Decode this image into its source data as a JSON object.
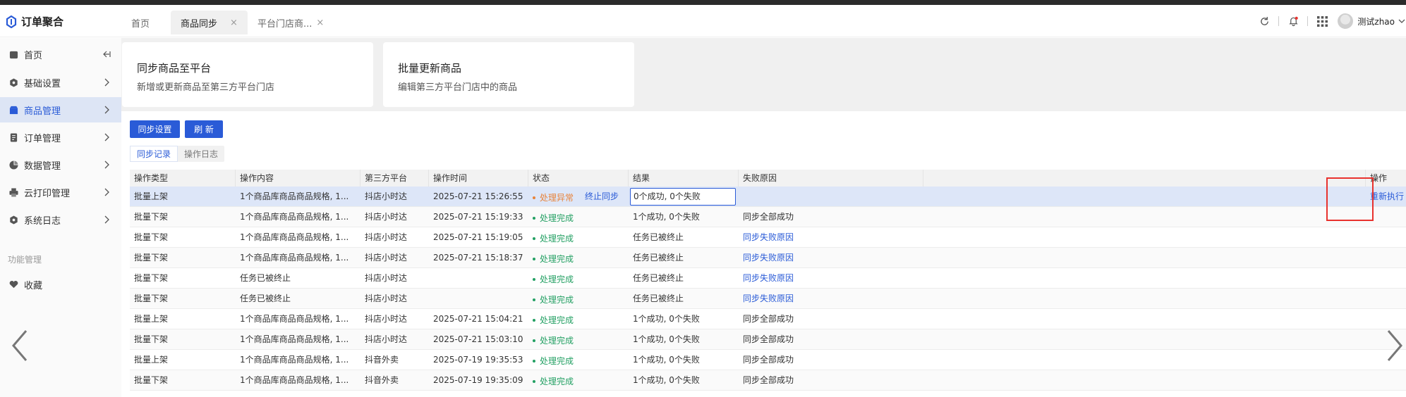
{
  "app": {
    "title": "订单聚合"
  },
  "tabs": [
    {
      "label": "首页"
    },
    {
      "label": "商品同步",
      "close": "×"
    },
    {
      "label": "平台门店商...",
      "close": "×"
    }
  ],
  "header": {
    "username": "测试zhao"
  },
  "sidebar": {
    "items": [
      {
        "label": "首页"
      },
      {
        "label": "基础设置"
      },
      {
        "label": "商品管理"
      },
      {
        "label": "订单管理"
      },
      {
        "label": "数据管理"
      },
      {
        "label": "云打印管理"
      },
      {
        "label": "系统日志"
      }
    ],
    "section_label": "功能管理",
    "favorite": "收藏"
  },
  "cards": [
    {
      "title": "同步商品至平台",
      "desc": "新增或更新商品至第三方平台门店"
    },
    {
      "title": "批量更新商品",
      "desc": "编辑第三方平台门店中的商品"
    }
  ],
  "toolbar": {
    "sync_settings": "同步设置",
    "refresh": "刷 新"
  },
  "subtabs": [
    {
      "label": "同步记录"
    },
    {
      "label": "操作日志"
    }
  ],
  "table": {
    "columns": [
      "操作类型",
      "操作内容",
      "第三方平台",
      "操作时间",
      "状态",
      "结果",
      "失败原因",
      "操作"
    ],
    "rows": [
      {
        "type": "批量上架",
        "content": "1个商品库商品商品规格, 1...",
        "platform": "抖店小时达",
        "time": "2025-07-21 15:26:55",
        "status": "处理异常",
        "status_link": "终止同步",
        "result": "0个成功, 0个失败",
        "reason": "",
        "action": "重新执行"
      },
      {
        "type": "批量下架",
        "content": "1个商品库商品商品规格, 1...",
        "platform": "抖店小时达",
        "time": "2025-07-21 15:19:33",
        "status": "处理完成",
        "result": "1个成功, 0个失败",
        "reason": "同步全部成功"
      },
      {
        "type": "批量下架",
        "content": "1个商品库商品商品规格, 1...",
        "platform": "抖店小时达",
        "time": "2025-07-21 15:19:05",
        "status": "处理完成",
        "result": "任务已被终止",
        "reason": "同步失败原因"
      },
      {
        "type": "批量下架",
        "content": "1个商品库商品商品规格, 1...",
        "platform": "抖店小时达",
        "time": "2025-07-21 15:18:37",
        "status": "处理完成",
        "result": "任务已被终止",
        "reason": "同步失败原因"
      },
      {
        "type": "批量下架",
        "content": "任务已被终止",
        "platform": "抖店小时达",
        "time": "",
        "status": "处理完成",
        "result": "任务已被终止",
        "reason": "同步失败原因"
      },
      {
        "type": "批量下架",
        "content": "任务已被终止",
        "platform": "抖店小时达",
        "time": "",
        "status": "处理完成",
        "result": "任务已被终止",
        "reason": "同步失败原因"
      },
      {
        "type": "批量上架",
        "content": "1个商品库商品商品规格, 1...",
        "platform": "抖店小时达",
        "time": "2025-07-21 15:04:21",
        "status": "处理完成",
        "result": "1个成功, 0个失败",
        "reason": "同步全部成功"
      },
      {
        "type": "批量下架",
        "content": "1个商品库商品商品规格, 1...",
        "platform": "抖店小时达",
        "time": "2025-07-21 15:03:10",
        "status": "处理完成",
        "result": "1个成功, 0个失败",
        "reason": "同步全部成功"
      },
      {
        "type": "批量上架",
        "content": "1个商品库商品商品规格, 1...",
        "platform": "抖音外卖",
        "time": "2025-07-19 19:35:53",
        "status": "处理完成",
        "result": "1个成功, 0个失败",
        "reason": "同步全部成功"
      },
      {
        "type": "批量下架",
        "content": "1个商品库商品商品规格, 1...",
        "platform": "抖音外卖",
        "time": "2025-07-19 19:35:09",
        "status": "处理完成",
        "result": "1个成功, 0个失败",
        "reason": "同步全部成功"
      }
    ]
  },
  "colors": {
    "primary": "#2a5bd7",
    "success": "#23a063",
    "warning": "#e8833a",
    "highlight": "#e8322e"
  }
}
